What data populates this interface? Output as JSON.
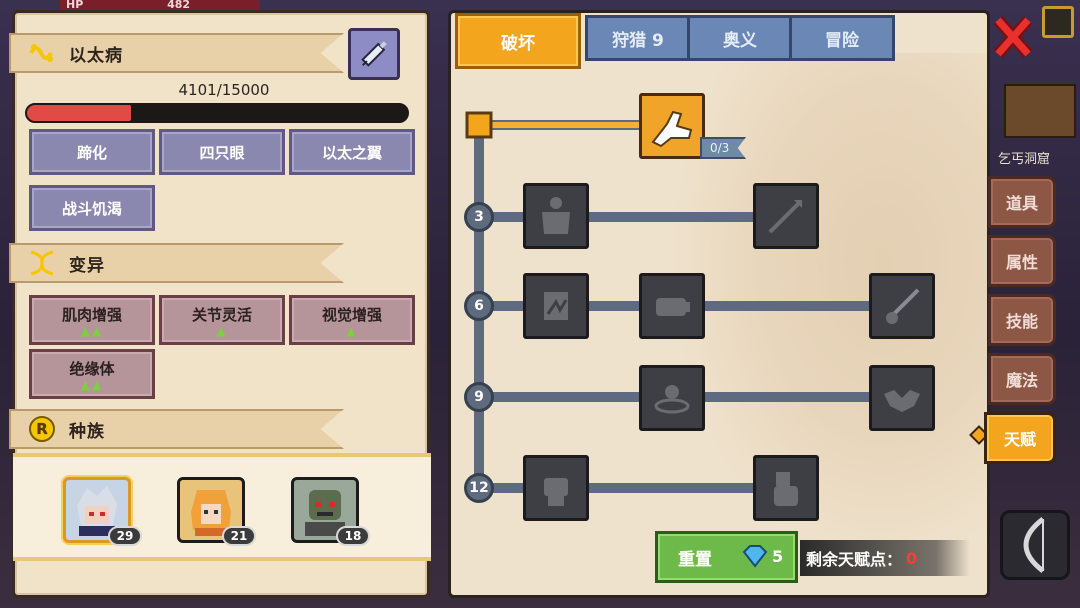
{
  "hud": {
    "hp_label": "HP",
    "hp_value": "482"
  },
  "disease": {
    "title": "以太病",
    "progress_text": "4101/15000",
    "progress_fraction": 0.2734,
    "symptoms": [
      "蹄化",
      "四只眼",
      "以太之翼",
      "战斗饥渴"
    ]
  },
  "mutation": {
    "title": "变异",
    "items": [
      {
        "label": "肌肉增强",
        "level": "▲▲"
      },
      {
        "label": "关节灵活",
        "level": "▲"
      },
      {
        "label": "视觉增强",
        "level": "▲"
      },
      {
        "label": "绝缘体",
        "level": "▲▲"
      }
    ]
  },
  "race": {
    "title": "种族",
    "icon_letter": "R",
    "characters": [
      {
        "level": "29"
      },
      {
        "level": "21"
      },
      {
        "level": "18"
      }
    ]
  },
  "talent_tabs": [
    "破坏",
    "狩猎 9",
    "奥义",
    "冒险"
  ],
  "talent_tree": {
    "root_count": "0/3",
    "tier_levels": [
      "3",
      "6",
      "9",
      "12"
    ]
  },
  "reset": {
    "label": "重置",
    "cost": "5"
  },
  "remaining_points": {
    "label": "剩余天赋点：",
    "value": "0"
  },
  "minimap": {
    "location": "乞丐洞窟"
  },
  "side_tabs": [
    "道具",
    "属性",
    "技能",
    "魔法",
    "天赋"
  ],
  "colors": {
    "accent_orange": "#f3a51d",
    "tab_blue": "#6b87b6",
    "chip_purple": "#8b88b0",
    "chip_mutation": "#b5949a",
    "side_tab_brown": "#8d5746",
    "progress_red": "#e14a46",
    "reset_green": "#6db94a"
  },
  "icons": {
    "disease": "syringe-icon",
    "mutation": "dna-icon",
    "root_skill": "arm-wrestle-icon",
    "close": "close-x-icon",
    "gem": "diamond-icon"
  }
}
